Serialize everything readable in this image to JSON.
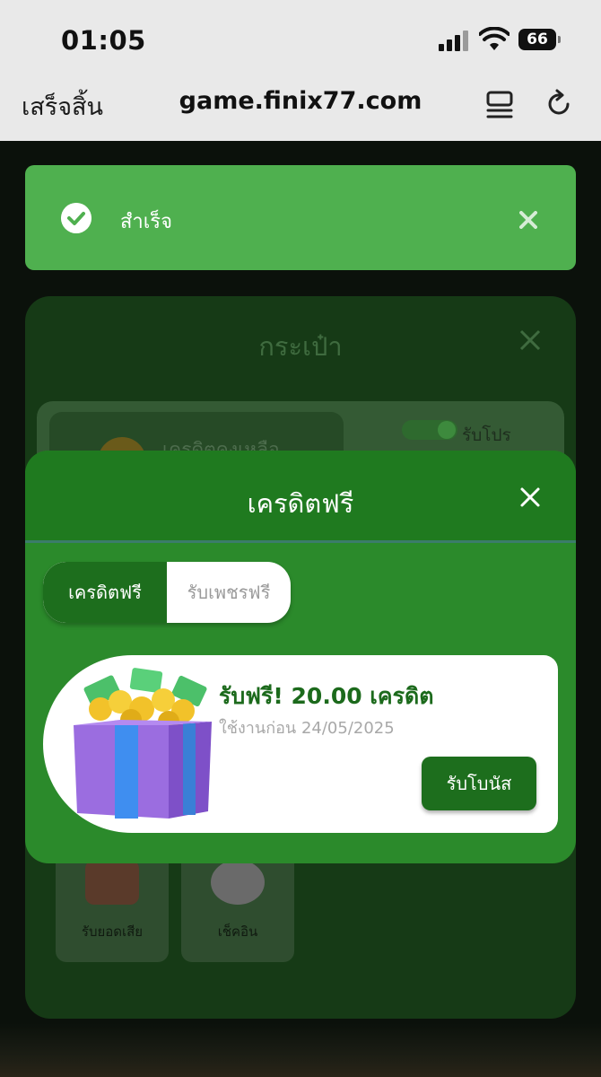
{
  "status_bar": {
    "time": "01:05",
    "battery": "66"
  },
  "browser": {
    "done_label": "เสร็จสิ้น",
    "url": "game.finix77.com"
  },
  "toast": {
    "message": "สำเร็จ",
    "color": "#4fb04f"
  },
  "wallet_modal": {
    "title": "กระเป๋า",
    "credit_label": "เครดิตคงเหลือ",
    "promo_toggle_label": "รับโปร",
    "tiles": [
      {
        "label": "รับยอดเสีย",
        "icon": "rebate-icon"
      },
      {
        "label": "เช็คอิน",
        "icon": "calendar-icon"
      }
    ]
  },
  "free_credit_modal": {
    "title": "เครดิตฟรี",
    "tabs": [
      {
        "label": "เครดิตฟรี",
        "active": true
      },
      {
        "label": "รับเพชรฟรี",
        "active": false
      }
    ],
    "reward": {
      "title": "รับฟรี! 20.00 เครดิต",
      "valid_until": "ใช้งานก่อน 24/05/2025",
      "button_label": "รับโบนัส",
      "icon": "gift-box-icon"
    },
    "accent_color": "#1d6e1d"
  }
}
